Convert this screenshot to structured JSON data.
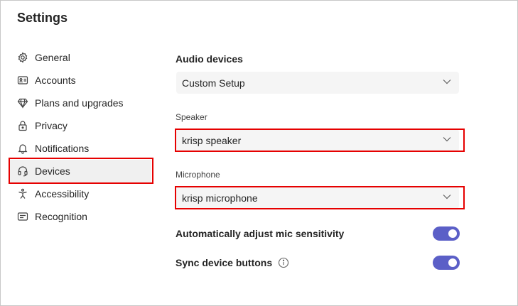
{
  "header": {
    "title": "Settings"
  },
  "sidebar": {
    "items": [
      {
        "label": "General",
        "icon": "gear-icon"
      },
      {
        "label": "Accounts",
        "icon": "id-card-icon"
      },
      {
        "label": "Plans and upgrades",
        "icon": "diamond-icon"
      },
      {
        "label": "Privacy",
        "icon": "lock-icon"
      },
      {
        "label": "Notifications",
        "icon": "bell-icon"
      },
      {
        "label": "Devices",
        "icon": "headset-icon",
        "selected": true
      },
      {
        "label": "Accessibility",
        "icon": "accessibility-icon"
      },
      {
        "label": "Recognition",
        "icon": "recognition-icon"
      }
    ]
  },
  "main": {
    "audio_devices": {
      "title": "Audio devices",
      "value": "Custom Setup"
    },
    "speaker": {
      "label": "Speaker",
      "value": "krisp speaker"
    },
    "microphone": {
      "label": "Microphone",
      "value": "krisp microphone"
    },
    "toggles": [
      {
        "label": "Automatically adjust mic sensitivity",
        "on": true
      },
      {
        "label": "Sync device buttons",
        "on": true,
        "info_icon": "info-icon"
      }
    ]
  },
  "colors": {
    "accent": "#5b5fc7",
    "highlight": "#e60000",
    "dropdown_bg": "#f5f5f5"
  }
}
